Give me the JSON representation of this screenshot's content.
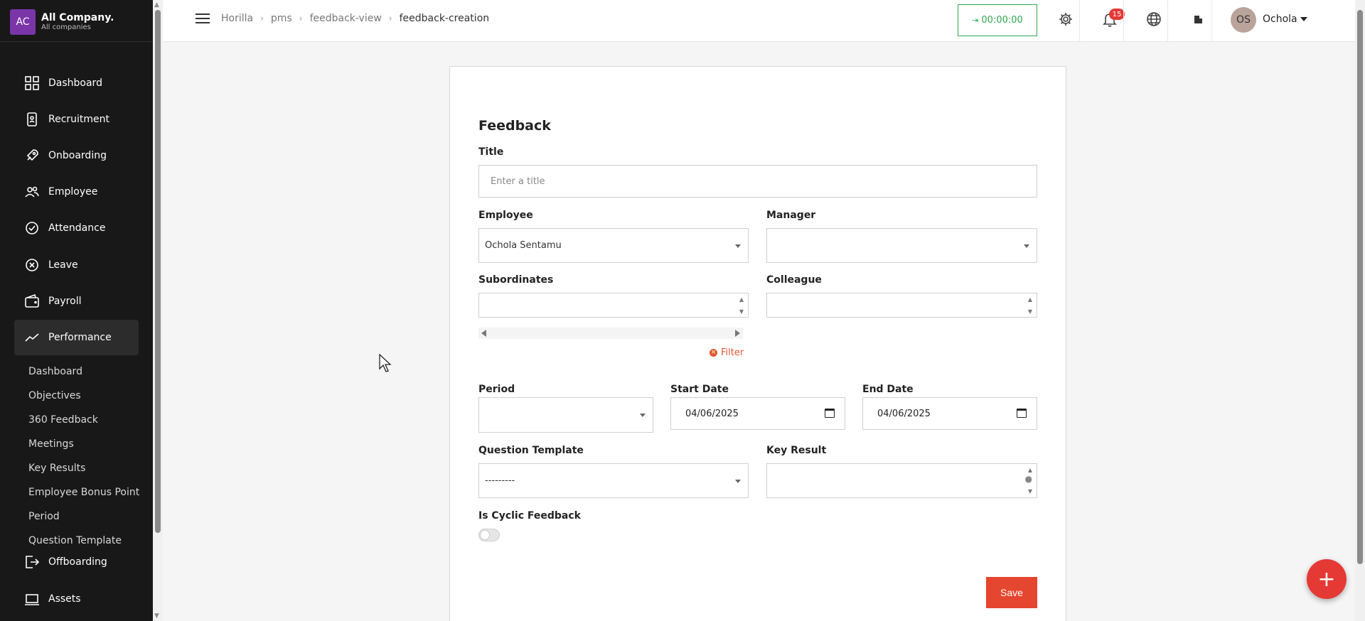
{
  "company": {
    "logo_text": "AC",
    "name": "All Company.",
    "subtitle": "All companies"
  },
  "sidebar": {
    "items": [
      {
        "label": "Dashboard",
        "icon": "dashboard-icon"
      },
      {
        "label": "Recruitment",
        "icon": "recruitment-icon"
      },
      {
        "label": "Onboarding",
        "icon": "rocket-icon"
      },
      {
        "label": "Employee",
        "icon": "users-icon"
      },
      {
        "label": "Attendance",
        "icon": "check-circle-icon"
      },
      {
        "label": "Leave",
        "icon": "x-circle-icon"
      },
      {
        "label": "Payroll",
        "icon": "wallet-icon"
      },
      {
        "label": "Performance",
        "icon": "trend-icon",
        "active": true
      },
      {
        "label": "Offboarding",
        "icon": "exit-icon"
      },
      {
        "label": "Assets",
        "icon": "laptop-icon"
      }
    ],
    "sub_items": [
      "Dashboard",
      "Objectives",
      "360 Feedback",
      "Meetings",
      "Key Results",
      "Employee Bonus Point",
      "Period",
      "Question Template"
    ]
  },
  "breadcrumb": [
    "Horilla",
    "pms",
    "feedback-view",
    "feedback-creation"
  ],
  "topbar": {
    "timer": "00:00:00",
    "notifications_count": "15",
    "user_initials": "OS",
    "user_name": "Ochola"
  },
  "form": {
    "heading": "Feedback",
    "title_label": "Title",
    "title_placeholder": "Enter a title",
    "employee_label": "Employee",
    "employee_value": "Ochola Sentamu",
    "manager_label": "Manager",
    "manager_value": "",
    "subordinates_label": "Subordinates",
    "colleague_label": "Colleague",
    "filter_label": "Filter",
    "period_label": "Period",
    "period_value": "",
    "start_date_label": "Start Date",
    "start_date_value": "04/06/2025",
    "end_date_label": "End Date",
    "end_date_value": "04/06/2025",
    "question_template_label": "Question Template",
    "question_template_value": "---------",
    "key_result_label": "Key Result",
    "cyclic_label": "Is Cyclic Feedback",
    "cyclic_on": false,
    "save_label": "Save"
  },
  "colors": {
    "accent": "#e5462f",
    "timer": "#2fa84f",
    "sidebar_bg": "#181818",
    "brand": "#7a35a8"
  }
}
